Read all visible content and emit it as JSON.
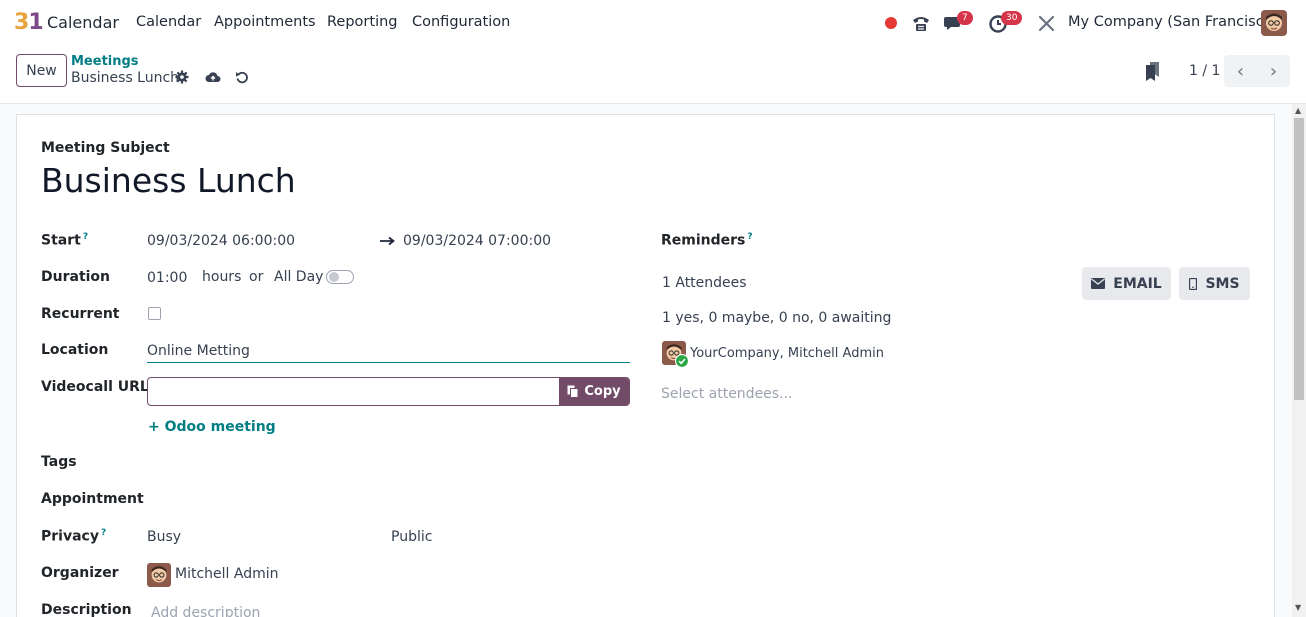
{
  "navbar": {
    "logo_digit1": "3",
    "logo_digit2": "1",
    "app_name": "Calendar",
    "menu": [
      "Calendar",
      "Appointments",
      "Reporting",
      "Configuration"
    ],
    "messages_badge": "7",
    "activities_badge": "30",
    "company": "My Company (San Francisco)"
  },
  "control": {
    "new_label": "New",
    "breadcrumb_parent": "Meetings",
    "breadcrumb_current": "Business Lunch",
    "pager": "1 / 1"
  },
  "form": {
    "subject_label": "Meeting Subject",
    "subject_value": "Business Lunch",
    "start_label": "Start",
    "start_help": "?",
    "start_value": "09/03/2024 06:00:00",
    "end_value": "09/03/2024 07:00:00",
    "duration_label": "Duration",
    "duration_value": "01:00",
    "hours_text": "hours",
    "or_text": "or",
    "all_day_text": "All Day",
    "recurrent_label": "Recurrent",
    "location_label": "Location",
    "location_value": "Online Metting",
    "videocall_label": "Videocall URL",
    "copy_label": "Copy",
    "odoo_meeting_label": "Odoo meeting",
    "tags_label": "Tags",
    "appointment_label": "Appointment",
    "privacy_label": "Privacy",
    "privacy_help": "?",
    "privacy_show_as": "Busy",
    "privacy_value": "Public",
    "organizer_label": "Organizer",
    "organizer_value": "Mitchell Admin",
    "description_label": "Description",
    "description_placeholder": "Add description",
    "reminders_label": "Reminders",
    "reminders_help": "?",
    "attendees_count": "1 Attendees",
    "attendees_summary": "1 yes, 0 maybe, 0 no, 0 awaiting",
    "attendee_name": "YourCompany, Mitchell Admin",
    "select_attendees_placeholder": "Select attendees...",
    "email_label": "EMAIL",
    "sms_label": "SMS"
  },
  "colors": {
    "brand": "#714b67",
    "link": "#017e84",
    "badge": "#d6344a",
    "record": "#e53935"
  }
}
